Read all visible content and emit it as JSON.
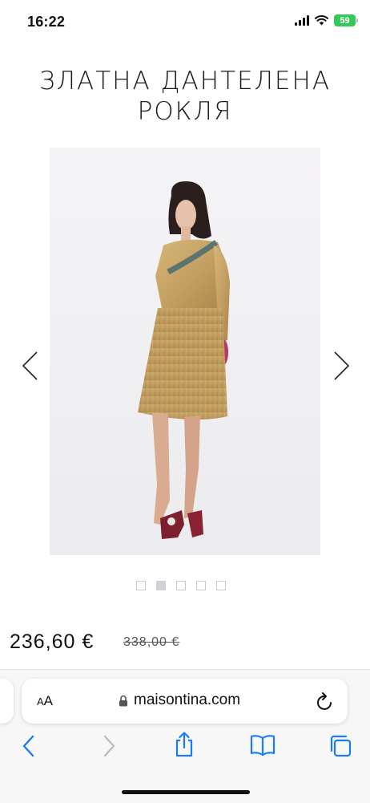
{
  "status": {
    "time": "16:22",
    "battery": "59"
  },
  "product": {
    "title_line1": "ЗЛАТНА ДАНТЕЛЕНА",
    "title_line2": "РОКЛЯ",
    "price": "236,60 €",
    "old_price": "338,00 €"
  },
  "gallery": {
    "dot_count": 5,
    "active_dot": 2
  },
  "browser": {
    "aa_label_small": "A",
    "aa_label_big": "A",
    "url": "maisontina.com"
  },
  "icons": {
    "prev": "chevron-left-icon",
    "next": "chevron-right-icon",
    "lock": "lock-icon",
    "reload": "reload-icon",
    "back": "back-icon",
    "forward": "forward-icon",
    "share": "share-icon",
    "bookmarks": "book-icon",
    "tabs": "tabs-icon"
  },
  "colors": {
    "accent": "#1a7cf5",
    "battery": "#34c759",
    "dress": "#c9a86a"
  }
}
